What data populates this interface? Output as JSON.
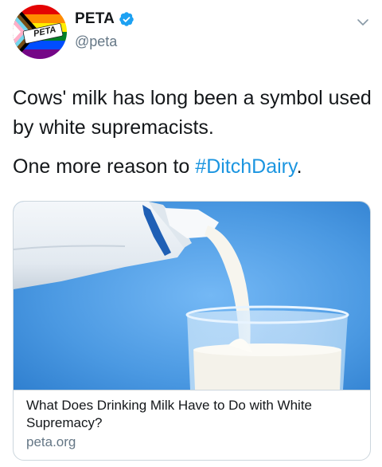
{
  "author": {
    "display_name": "PETA",
    "handle": "@peta",
    "avatar_text": "PETA",
    "verified": true
  },
  "tweet": {
    "line1": "Cows' milk has long been a symbol used by white supremacists.",
    "line2_prefix": "One more reason to ",
    "hashtag": "#DitchDairy",
    "line2_suffix": "."
  },
  "card": {
    "title": "What Does Drinking Milk Have to Do with White Supremacy?",
    "domain": "peta.org"
  },
  "colors": {
    "hashtag": "#1b95e0",
    "verified": "#1da1f2",
    "secondary_text": "#657786",
    "card_bg_blue": "#4d9de6"
  },
  "icons": [
    "verified-badge-icon",
    "chevron-down-icon"
  ]
}
